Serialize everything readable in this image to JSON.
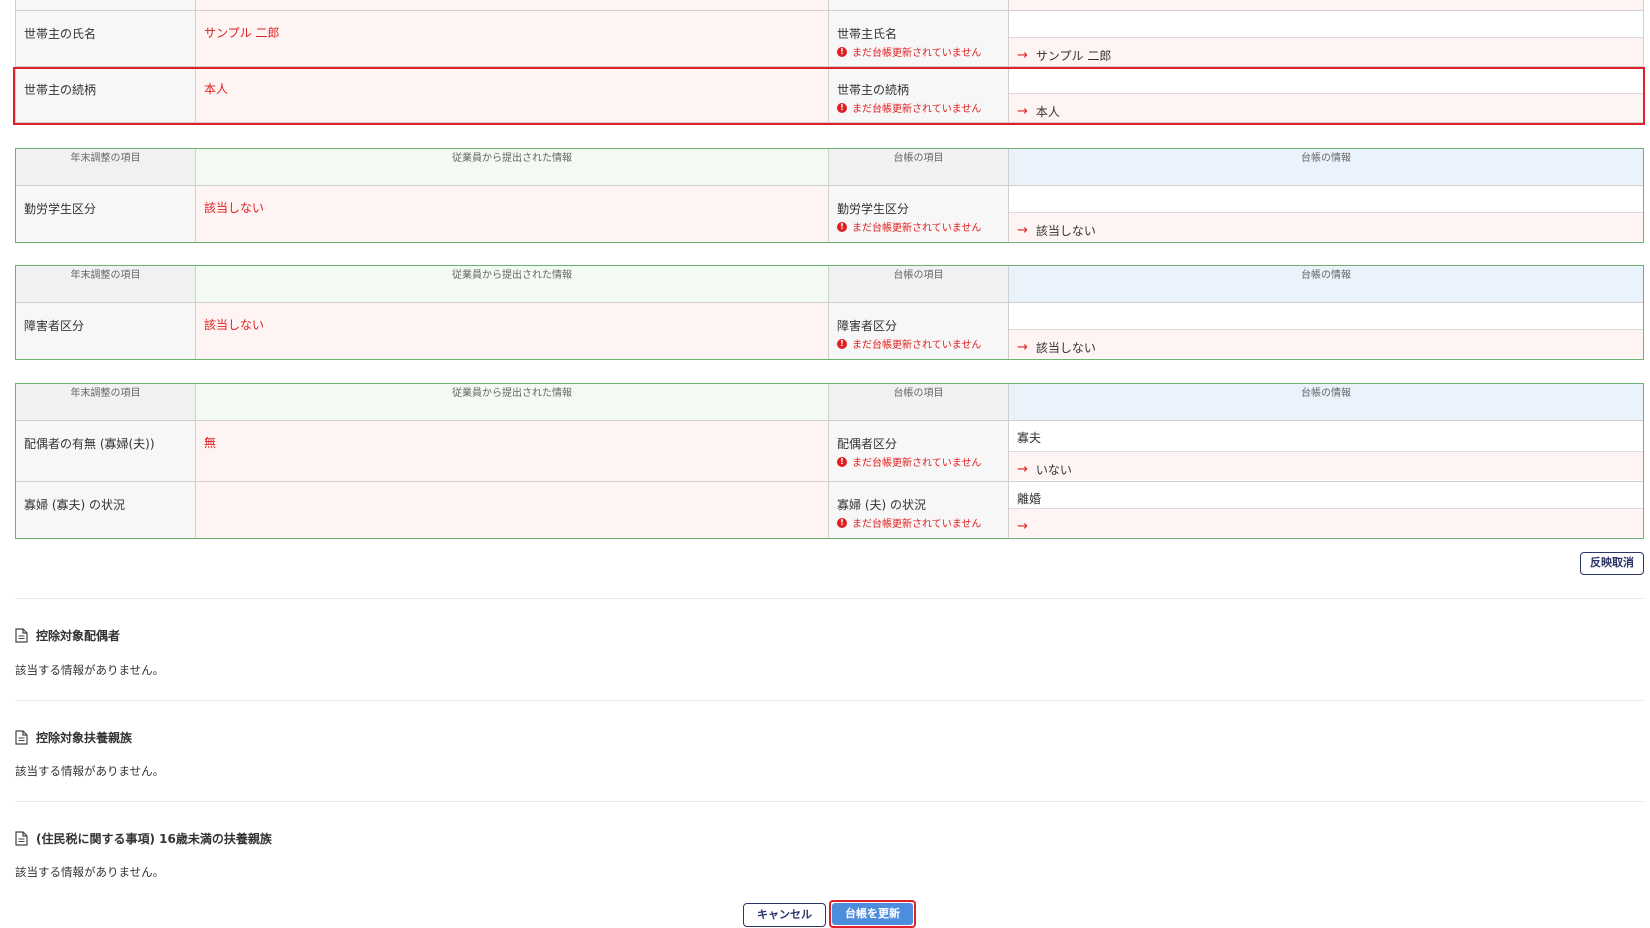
{
  "top_block": {
    "rows": [
      {
        "label": "世帯主の氏名",
        "employee_value": "サンプル 二郎",
        "ledger_label": "世帯主氏名",
        "warning": "まだ台帳更新されていません",
        "current_value": "",
        "new_value": "サンプル 二郎"
      },
      {
        "label": "世帯主の続柄",
        "employee_value": "本人",
        "ledger_label": "世帯主の続柄",
        "warning": "まだ台帳更新されていません",
        "current_value": "",
        "new_value": "本人"
      }
    ]
  },
  "headers": {
    "h1": "年末調整の項目",
    "h2": "従業員から提出された情報",
    "h3": "台帳の項目",
    "h4": "台帳の情報"
  },
  "blocks": [
    {
      "rows": [
        {
          "label": "勤労学生区分",
          "employee_value": "該当しない",
          "ledger_label": "勤労学生区分",
          "warning": "まだ台帳更新されていません",
          "current_value": "",
          "new_value": "該当しない"
        }
      ]
    },
    {
      "rows": [
        {
          "label": "障害者区分",
          "employee_value": "該当しない",
          "ledger_label": "障害者区分",
          "warning": "まだ台帳更新されていません",
          "current_value": "",
          "new_value": "該当しない"
        }
      ]
    },
    {
      "rows": [
        {
          "label": "配偶者の有無 (寡婦(夫))",
          "employee_value": "無",
          "ledger_label": "配偶者区分",
          "warning": "まだ台帳更新されていません",
          "current_value": "寡夫",
          "new_value": "いない"
        },
        {
          "label": "寡婦 (寡夫) の状況",
          "employee_value": "",
          "ledger_label": "寡婦 (夫) の状況",
          "warning": "まだ台帳更新されていません",
          "current_value": "離婚",
          "new_value": ""
        }
      ]
    }
  ],
  "revert_button": "反映取消",
  "sections": [
    {
      "title": "控除対象配偶者",
      "body": "該当する情報がありません。"
    },
    {
      "title": "控除対象扶養親族",
      "body": "該当する情報がありません。"
    },
    {
      "title": "(住民税に関する事項) 16歳未満の扶養親族",
      "body": "該当する情報がありません。"
    }
  ],
  "footer": {
    "cancel": "キャンセル",
    "update": "台帳を更新"
  },
  "colors": {
    "accent_red": "#e02020",
    "primary_blue": "#4d8ddd",
    "navy": "#2b3567",
    "green_border": "#6db36d"
  },
  "icons": {
    "arrow": "→",
    "warning": "!",
    "document": "document-icon"
  }
}
